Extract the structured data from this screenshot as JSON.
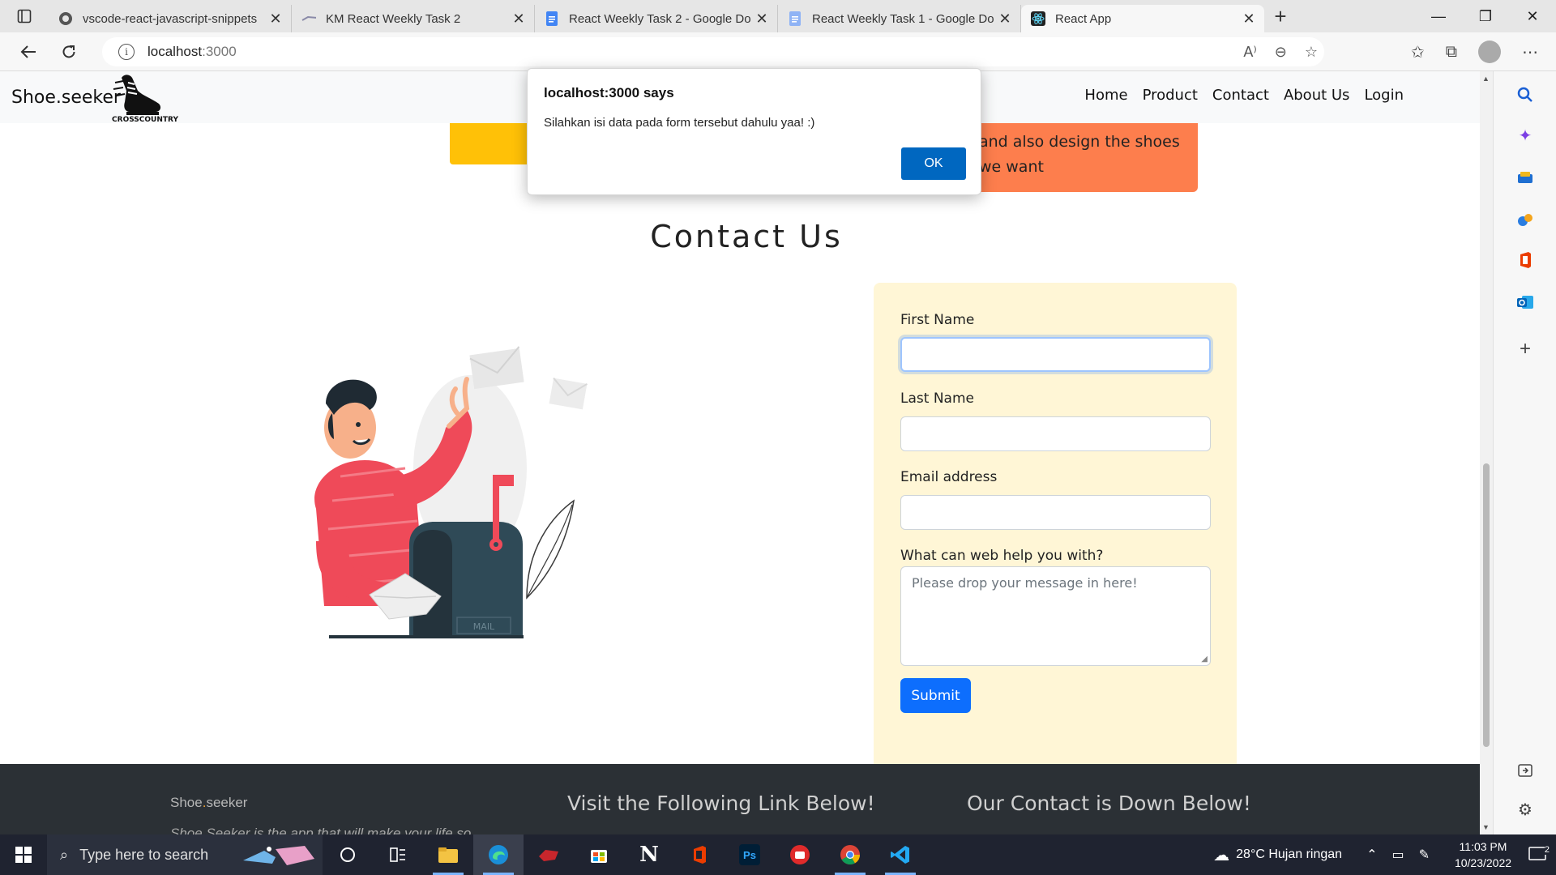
{
  "browser": {
    "tabs": [
      {
        "title": "vscode-react-javascript-snippets",
        "icon": "github-icon"
      },
      {
        "title": "KM React Weekly Task 2",
        "icon": "km-icon"
      },
      {
        "title": "React Weekly Task 2 - Google Do",
        "icon": "google-docs-icon"
      },
      {
        "title": "React Weekly Task 1 - Google Do",
        "icon": "google-docs-icon"
      },
      {
        "title": "React App",
        "icon": "react-icon",
        "active": true
      }
    ],
    "url_host": "localhost",
    "url_port": ":3000"
  },
  "site": {
    "brand": "Shoe.seeker",
    "logo_text": "CROSSCOUNTRY",
    "nav": [
      "Home",
      "Product",
      "Contact",
      "About Us",
      "Login"
    ],
    "hero_text_line1": "and also design the shoes",
    "hero_text_line2": "we want",
    "section_title": "Contact Us",
    "mailbox_label": "MAIL",
    "form": {
      "first_name_label": "First Name",
      "last_name_label": "Last Name",
      "email_label": "Email address",
      "message_label": "What can web help you with?",
      "message_placeholder": "Please drop your message in here!",
      "submit_label": "Submit"
    },
    "footer": {
      "brand_a": "Shoe",
      "brand_dot": ".",
      "brand_b": "seeker",
      "tagline": "Shoe Seeker is the app that will make your life so",
      "heading_links": "Visit the Following Link Below!",
      "heading_contact": "Our Contact is Down Below!"
    }
  },
  "dialog": {
    "title": "localhost:3000 says",
    "message": "Silahkan isi data pada form tersebut dahulu yaa! :)",
    "ok_label": "OK"
  },
  "taskbar": {
    "search_placeholder": "Type here to search",
    "weather": "28°C  Hujan ringan",
    "time": "11:03 PM",
    "date": "10/23/2022",
    "notification_count": "2"
  },
  "colors": {
    "accent": "#0d6efd",
    "form_bg": "#fff6d6",
    "hero_yellow": "#ffc107",
    "hero_orange": "#fd7e4d",
    "footer_bg": "#2b3035",
    "illustration_red": "#ef4a59",
    "mailbox_teal": "#2f4a57"
  }
}
